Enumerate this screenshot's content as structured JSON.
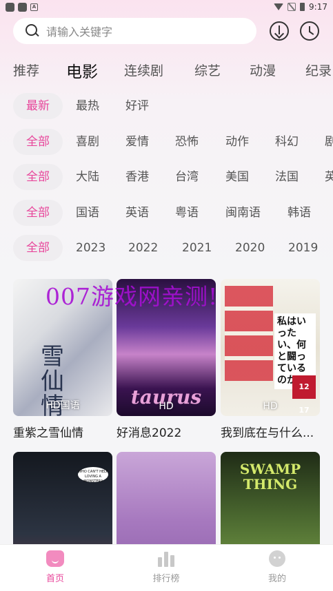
{
  "status_bar": {
    "time": "9:17"
  },
  "search": {
    "placeholder": "请输入关键字"
  },
  "category_tabs": [
    {
      "label": "推荐"
    },
    {
      "label": "电影",
      "active": true
    },
    {
      "label": "连续剧"
    },
    {
      "label": "综艺"
    },
    {
      "label": "动漫"
    },
    {
      "label": "纪录"
    }
  ],
  "filters": {
    "sort": [
      "最新",
      "最热",
      "好评"
    ],
    "genre": [
      "全部",
      "喜剧",
      "爱情",
      "恐怖",
      "动作",
      "科幻",
      "剧"
    ],
    "region": [
      "全部",
      "大陆",
      "香港",
      "台湾",
      "美国",
      "法国",
      "英"
    ],
    "language": [
      "全部",
      "国语",
      "英语",
      "粤语",
      "闽南语",
      "韩语"
    ],
    "year": [
      "全部",
      "2023",
      "2022",
      "2021",
      "2020",
      "2019"
    ]
  },
  "movies": [
    {
      "title": "重紫之雪仙情",
      "badge": "HD国语",
      "poster_text": "雪仙情"
    },
    {
      "title": "好消息2022",
      "badge": "HD",
      "poster_text": "taurus"
    },
    {
      "title": "我到底在与什么...",
      "badge": "HD",
      "poster_text": "私はいったい、何と闘っているのか",
      "poster_date": "12 17"
    },
    {
      "title": "",
      "badge": "",
      "poster_text": "WHO CAN'T HELP LOVING A MONSTER?"
    },
    {
      "title": "",
      "badge": ""
    },
    {
      "title": "",
      "badge": "",
      "poster_text": "SWAMP THING"
    }
  ],
  "watermark": "007游戏网亲测!",
  "bottom_nav": [
    {
      "label": "首页",
      "icon": "home-icon",
      "active": true
    },
    {
      "label": "排行榜",
      "icon": "ranking-icon"
    },
    {
      "label": "我的",
      "icon": "profile-icon"
    }
  ],
  "colors": {
    "accent": "#e8469b",
    "chip_bg": "#efedf0"
  }
}
